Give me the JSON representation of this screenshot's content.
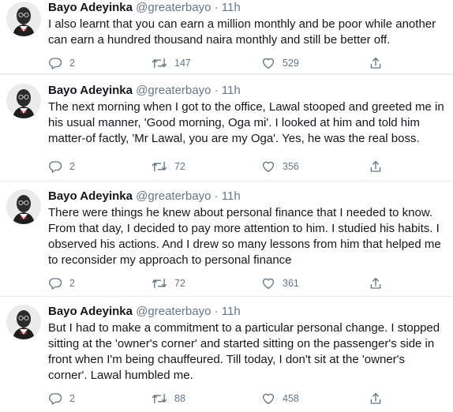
{
  "tweets": [
    {
      "name": "Bayo Adeyinka",
      "handle": "@greaterbayo",
      "separator": "·",
      "time": "11h",
      "lines": [
        "I also learnt that you can earn a million monthly and be poor while another",
        "can earn a hundred thousand naira monthly and still be better off."
      ],
      "replies": "2",
      "retweets": "147",
      "likes": "529"
    },
    {
      "name": "Bayo Adeyinka",
      "handle": "@greaterbayo",
      "separator": "·",
      "time": "11h",
      "lines": [
        "The next morning when I got to the office, Lawal stooped and greeted me in",
        "his usual manner, 'Good morning, Oga mi'. I looked at him and told him",
        "matter-of factly, 'Mr Lawal, you are my Oga'. Yes, he was the real boss."
      ],
      "replies": "2",
      "retweets": "72",
      "likes": "356"
    },
    {
      "name": "Bayo Adeyinka",
      "handle": "@greaterbayo",
      "separator": "·",
      "time": "11h",
      "lines": [
        "There were things he knew about personal finance that I needed to know.",
        "From that day, I decided to pay more attention to him. I studied his habits. I",
        "observed his actions. And I drew so many lessons from him that helped me",
        "to reconsider my approach to personal finance"
      ],
      "replies": "2",
      "retweets": "72",
      "likes": "361"
    },
    {
      "name": "Bayo Adeyinka",
      "handle": "@greaterbayo",
      "separator": "·",
      "time": "11h",
      "lines": [
        "But I had to make a commitment to a particular personal change. I stopped",
        "sitting at the 'owner's corner' and started sitting on the passenger's side in",
        "front when I'm being chauffeured. Till today, I don't sit at the 'owner's",
        "corner'. Lawal humbled me."
      ],
      "replies": "2",
      "retweets": "88",
      "likes": "458"
    }
  ],
  "icons": {
    "reply": "reply-bubble-icon",
    "retweet": "retweet-arrows-icon",
    "like": "heart-outline-icon",
    "share": "share-upload-icon"
  },
  "colors": {
    "text": "#14171a",
    "muted": "#657786",
    "divider": "#e6ecf0"
  }
}
